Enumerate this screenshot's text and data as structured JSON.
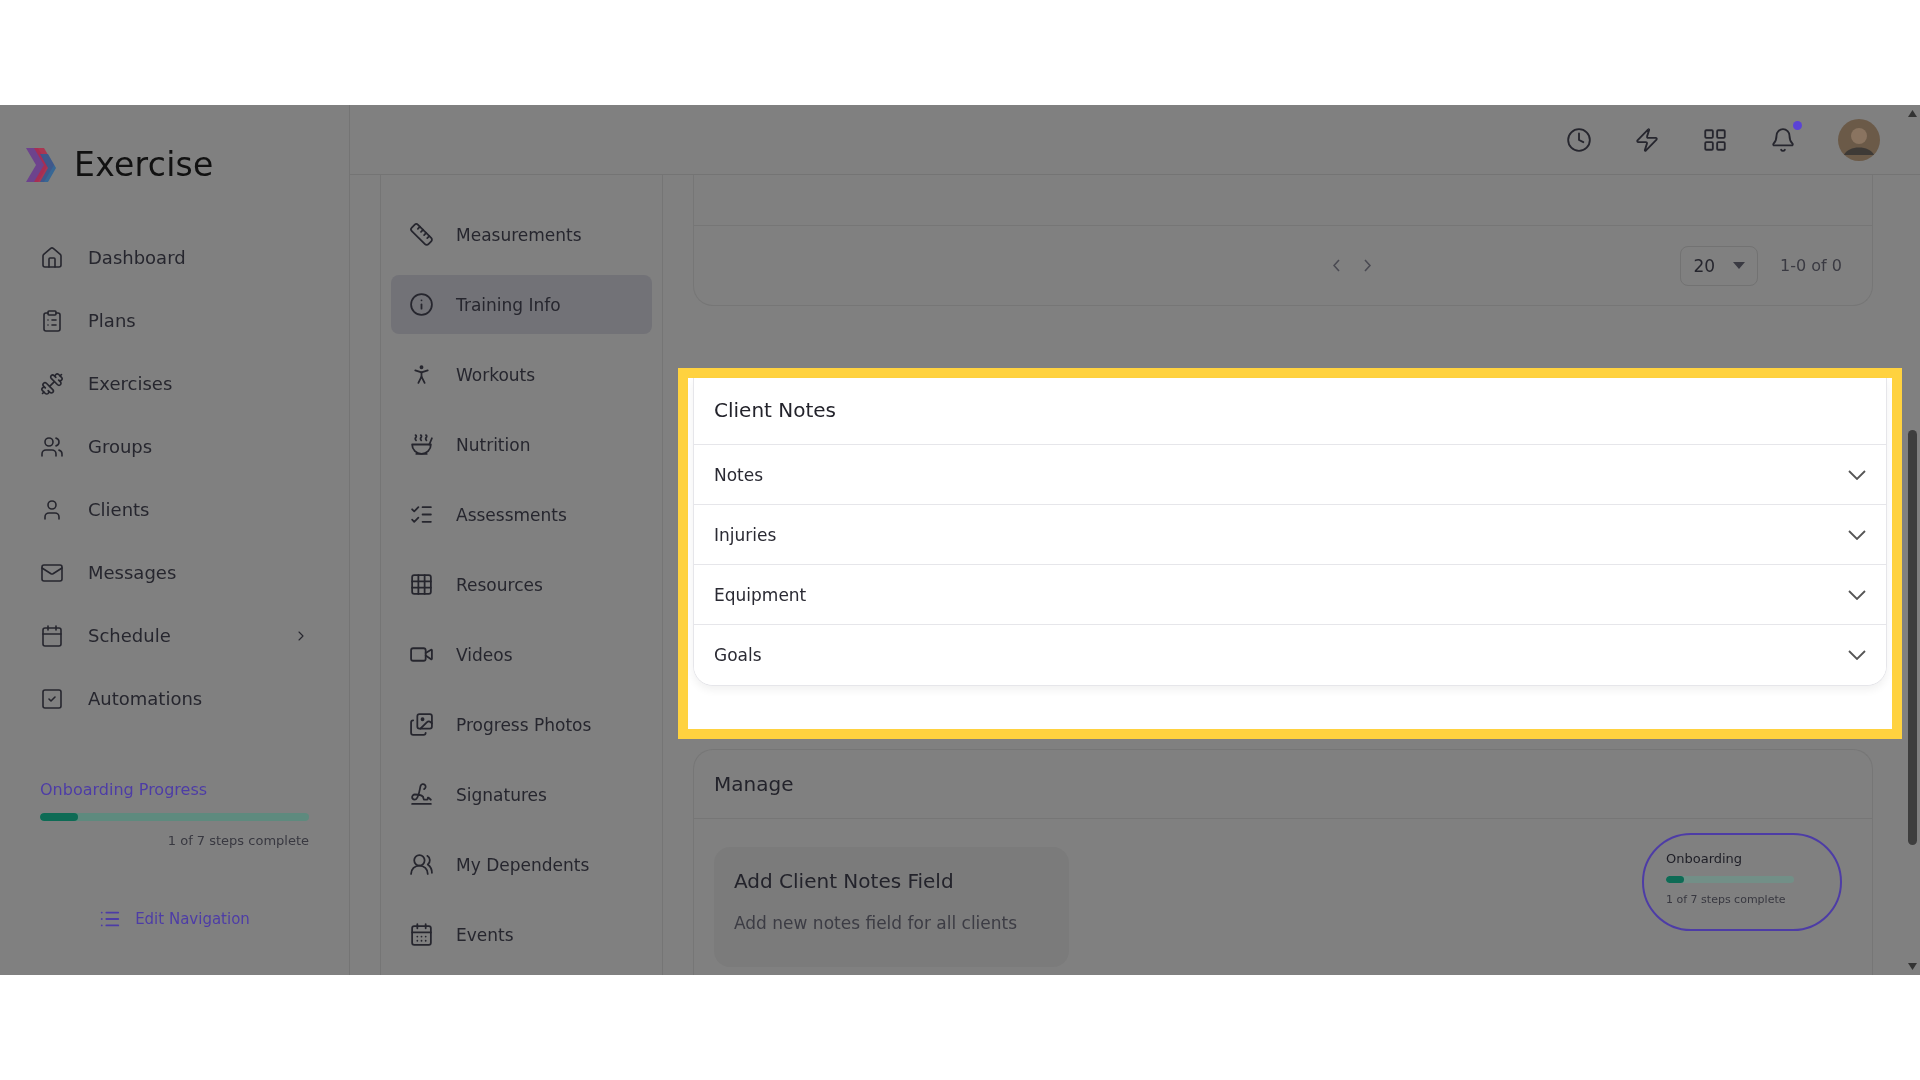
{
  "brand": {
    "name": "Exercise"
  },
  "main_nav": [
    {
      "label": "Dashboard",
      "expandable": false
    },
    {
      "label": "Plans",
      "expandable": false
    },
    {
      "label": "Exercises",
      "expandable": false
    },
    {
      "label": "Groups",
      "expandable": false
    },
    {
      "label": "Clients",
      "expandable": false
    },
    {
      "label": "Messages",
      "expandable": false
    },
    {
      "label": "Schedule",
      "expandable": true
    },
    {
      "label": "Automations",
      "expandable": false
    }
  ],
  "onboarding_progress": {
    "title": "Onboarding Progress",
    "level": 0.14,
    "caption": "1 of 7 steps complete"
  },
  "edit_navigation": {
    "label": "Edit Navigation"
  },
  "client_nav": [
    {
      "label": "Measurements",
      "selected": false
    },
    {
      "label": "Training Info",
      "selected": true
    },
    {
      "label": "Workouts",
      "selected": false
    },
    {
      "label": "Nutrition",
      "selected": false
    },
    {
      "label": "Assessments",
      "selected": false
    },
    {
      "label": "Resources",
      "selected": false
    },
    {
      "label": "Videos",
      "selected": false
    },
    {
      "label": "Progress Photos",
      "selected": false
    },
    {
      "label": "Signatures",
      "selected": false
    },
    {
      "label": "My Dependents",
      "selected": false
    },
    {
      "label": "Events",
      "selected": false
    }
  ],
  "top_bar": {
    "notifications_unread": true
  },
  "pagination": {
    "page_size": "20",
    "range": "1-0 of 0"
  },
  "client_notes": {
    "title": "Client Notes",
    "sections": [
      {
        "label": "Notes",
        "expanded": false
      },
      {
        "label": "Injuries",
        "expanded": false
      },
      {
        "label": "Equipment",
        "expanded": false
      },
      {
        "label": "Goals",
        "expanded": false
      }
    ]
  },
  "manage": {
    "title": "Manage",
    "card": {
      "title": "Add Client Notes Field",
      "description": "Add new notes field for all clients"
    }
  },
  "onboarding_widget": {
    "title": "Onboarding",
    "level": 0.14,
    "caption": "1 of 7 steps complete"
  }
}
